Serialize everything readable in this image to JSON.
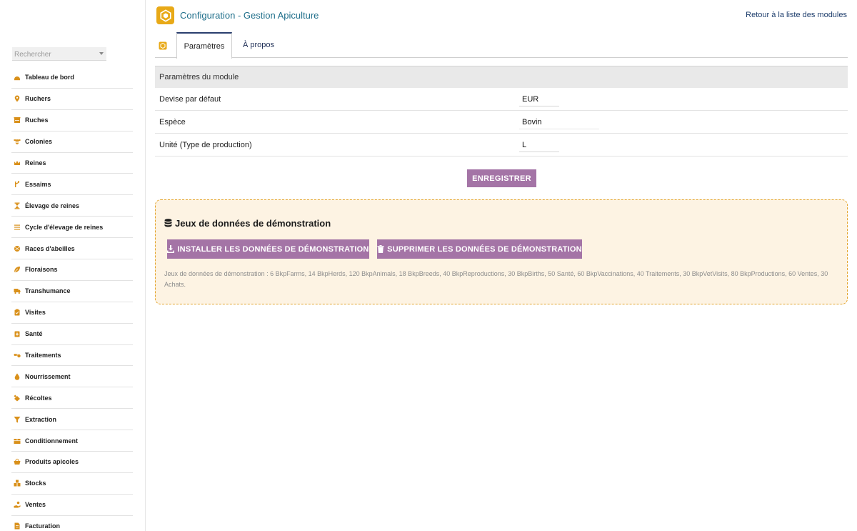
{
  "header": {
    "title": "Configuration - Gestion Apiculture",
    "back_link": "Retour à la liste des modules",
    "logo_icon": "hexagon-logo-icon",
    "brand_color": "#e8a917"
  },
  "sidebar": {
    "search_placeholder": "Rechercher",
    "items": [
      {
        "label": "Tableau de bord",
        "icon": "dashboard-icon"
      },
      {
        "label": "Ruchers",
        "icon": "map-pin-icon"
      },
      {
        "label": "Ruches",
        "icon": "hive-box-icon"
      },
      {
        "label": "Colonies",
        "icon": "bee-icon"
      },
      {
        "label": "Reines",
        "icon": "crown-icon"
      },
      {
        "label": "Essaims",
        "icon": "branch-icon"
      },
      {
        "label": "Élevage de reines",
        "icon": "hourglass-icon"
      },
      {
        "label": "Cycle d'élevage de reines",
        "icon": "list-icon"
      },
      {
        "label": "Races d'abeilles",
        "icon": "dna-icon"
      },
      {
        "label": "Floraisons",
        "icon": "leaf-icon"
      },
      {
        "label": "Transhumance",
        "icon": "truck-icon"
      },
      {
        "label": "Visites",
        "icon": "clipboard-check-icon"
      },
      {
        "label": "Santé",
        "icon": "medical-kit-icon"
      },
      {
        "label": "Traitements",
        "icon": "pills-icon"
      },
      {
        "label": "Nourrissement",
        "icon": "drop-icon"
      },
      {
        "label": "Récoltes",
        "icon": "harvest-icon"
      },
      {
        "label": "Extraction",
        "icon": "funnel-icon"
      },
      {
        "label": "Conditionnement",
        "icon": "box-icon"
      },
      {
        "label": "Produits apicoles",
        "icon": "basket-icon"
      },
      {
        "label": "Stocks",
        "icon": "boxes-icon"
      },
      {
        "label": "Ventes",
        "icon": "hand-coin-icon"
      },
      {
        "label": "Facturation",
        "icon": "invoice-icon"
      }
    ],
    "icon_color": "#d9901a"
  },
  "tabs": [
    {
      "label": "Paramètres",
      "active": true
    },
    {
      "label": "À propos",
      "active": false
    }
  ],
  "params": {
    "section_title": "Paramètres du module",
    "rows": [
      {
        "label": "Devise par défaut",
        "value": "EUR"
      },
      {
        "label": "Espèce",
        "value": "Bovin"
      },
      {
        "label": "Unité (Type de production)",
        "value": "L"
      }
    ],
    "save_label": "ENREGISTRER"
  },
  "demo": {
    "title": "Jeux de données de démonstration",
    "install_label": "INSTALLER LES DONNÉES DE DÉMONSTRATION",
    "delete_label": "SUPPRIMER LES DONNÉES DE DÉMONSTRATION",
    "description": "Jeux de données de démonstration : 6 BkpFarms, 14 BkpHerds, 120 BkpAnimals, 18 BkpBreeds, 40 BkpReproductions, 30 BkpBirths, 50 Santé, 60 BkpVaccinations, 40 Traitements, 30 BkpVetVisits, 80 BkpProductions, 60 Ventes, 30 Achats.",
    "button_color": "#a474a6",
    "box_border_color": "#e3a42b",
    "box_bg_color": "#fdf3e3"
  }
}
